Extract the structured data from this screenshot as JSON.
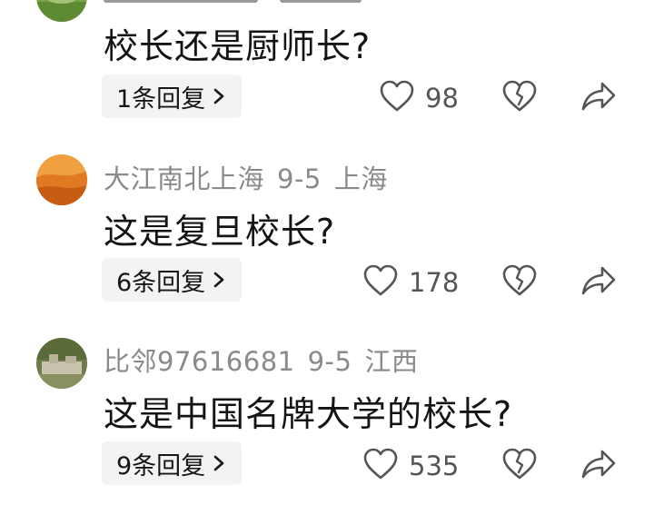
{
  "comments": [
    {
      "text": "校长还是厨师长?",
      "reply_label": "1条回复",
      "likes": "98",
      "avatar": "green-field-avatar"
    },
    {
      "username": "大江南北上海",
      "date": "9-5",
      "location": "上海",
      "text": "这是复旦校长?",
      "reply_label": "6条回复",
      "likes": "178",
      "avatar": "orange-desert-avatar"
    },
    {
      "username": "比邻97616681",
      "date": "9-5",
      "location": "江西",
      "text": "这是中国名牌大学的校长?",
      "reply_label": "9条回复",
      "likes": "535",
      "avatar": "stone-garden-avatar"
    }
  ],
  "icons": {
    "like": "heart-icon",
    "dislike": "broken-heart-icon",
    "share": "share-arrow-icon",
    "reply": "chevron-right-icon"
  },
  "colors": {
    "meta_text": "#8a8a8a",
    "reply_bg": "#f3f3f3",
    "icon_stroke": "#555555"
  }
}
